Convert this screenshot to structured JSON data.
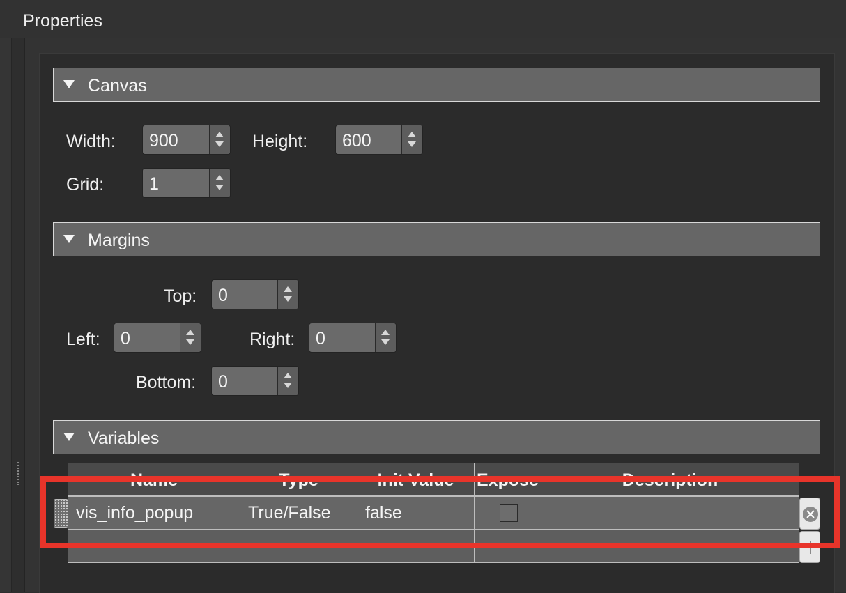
{
  "panel": {
    "title": "Properties"
  },
  "canvas": {
    "section_title": "Canvas",
    "width_label": "Width:",
    "width_value": "900",
    "height_label": "Height:",
    "height_value": "600",
    "grid_label": "Grid:",
    "grid_value": "1"
  },
  "margins": {
    "section_title": "Margins",
    "top_label": "Top:",
    "top_value": "0",
    "left_label": "Left:",
    "left_value": "0",
    "right_label": "Right:",
    "right_value": "0",
    "bottom_label": "Bottom:",
    "bottom_value": "0"
  },
  "variables": {
    "section_title": "Variables",
    "columns": [
      "Name",
      "Type",
      "Init Value",
      "Expose",
      "Description"
    ],
    "rows": [
      {
        "name": "vis_info_popup",
        "type": "True/False",
        "init_value": "false",
        "expose": false,
        "description": ""
      }
    ]
  },
  "colors": {
    "background": "#2e2e2e",
    "section_header": "#666666",
    "highlight_box": "#e8342a"
  }
}
